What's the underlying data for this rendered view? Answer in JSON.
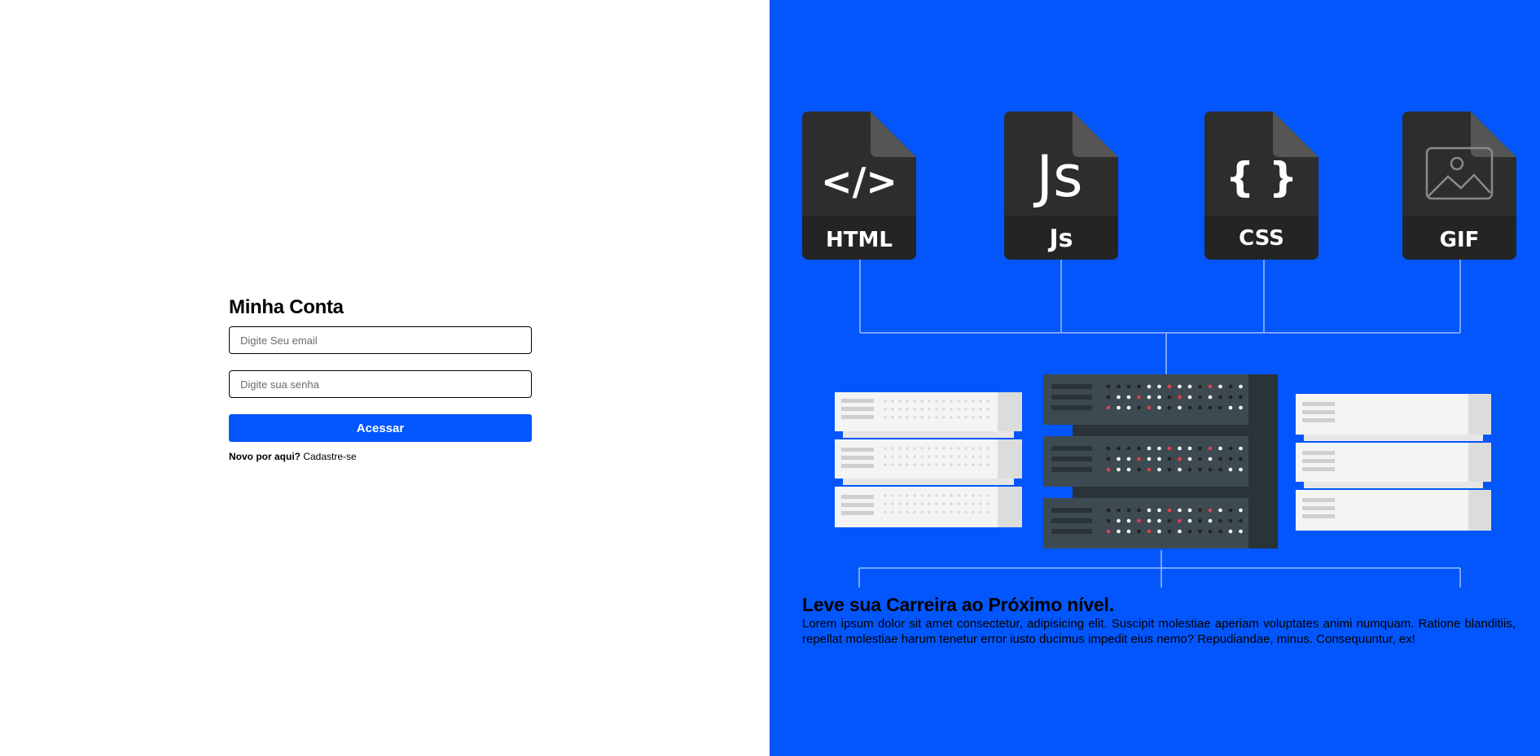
{
  "login": {
    "title": "Minha Conta",
    "email_placeholder": "Digite Seu email",
    "password_placeholder": "Digite sua senha",
    "submit_label": "Acessar",
    "signup_question": "Novo por aqui?",
    "signup_link": "Cadastre-se"
  },
  "hero": {
    "files": [
      {
        "label": "HTML",
        "symbol": "</>"
      },
      {
        "label": "Js",
        "symbol": "Js"
      },
      {
        "label": "CSS",
        "symbol": "{ }"
      },
      {
        "label": "GIF",
        "symbol": "image-icon"
      }
    ],
    "heading": "Leve sua Carreira ao Próximo nível.",
    "body": "Lorem ipsum dolor sit amet consectetur, adipisicing elit. Suscipit molestiae aperiam voluptates animi numquam. Ratione blanditiis, repellat molestiae harum tenetur error iusto ducimus impedit eius nemo? Repudiandae, minus. Consequuntur, ex!"
  },
  "colors": {
    "brand_blue": "#0256fb",
    "file_dark": "#2d2d2d",
    "server_dark": "#3e4a52",
    "server_light": "#f2f2f2"
  }
}
